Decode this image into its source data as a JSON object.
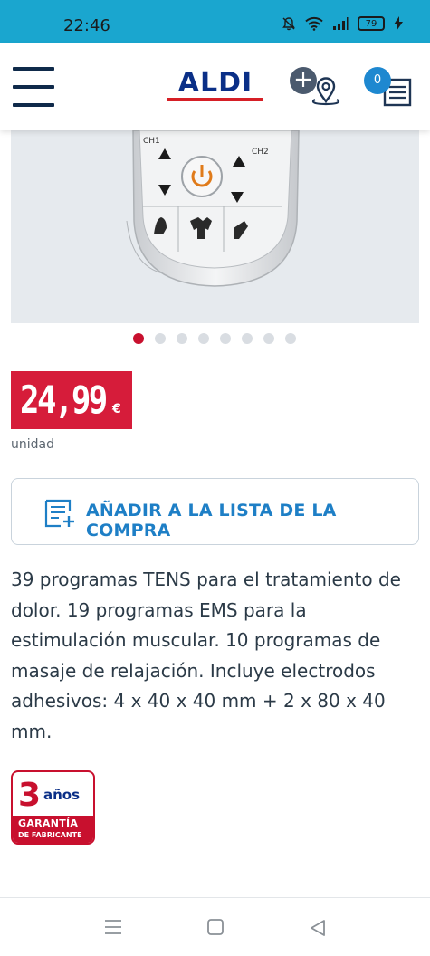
{
  "status_bar": {
    "time": "22:46",
    "battery": "79"
  },
  "header": {
    "logo_text": "ALDI",
    "cart_count": "0",
    "icons": [
      "menu-icon",
      "add-store-icon",
      "location-pin-icon",
      "shopping-list-icon"
    ]
  },
  "gallery": {
    "image_labels": [
      "CH1",
      "CH2"
    ],
    "slide_count": 8,
    "active_index": 0
  },
  "price": {
    "value": "24,99",
    "currency": "€",
    "unit": "unidad"
  },
  "add_to_list": {
    "label": "AÑADIR A LA LISTA DE LA COMPRA"
  },
  "description": "39 programas TENS para el tratamiento de dolor. 19 programas EMS para la estimulación muscular. 10 programas de masaje de relajación. Incluye electrodos adhesivos: 4 x 40 x 40 mm + 2 x 80 x 40 mm.",
  "warranty": {
    "years": "3",
    "years_label": "años",
    "line1": "GARANTÍA",
    "line2": "DE FABRICANTE"
  },
  "colors": {
    "status_bar": "#1aa6cf",
    "aldi_blue": "#0a2f87",
    "price_red": "#d61c3a",
    "link_blue": "#1e7fc6",
    "cart_badge": "#1e88d0"
  }
}
